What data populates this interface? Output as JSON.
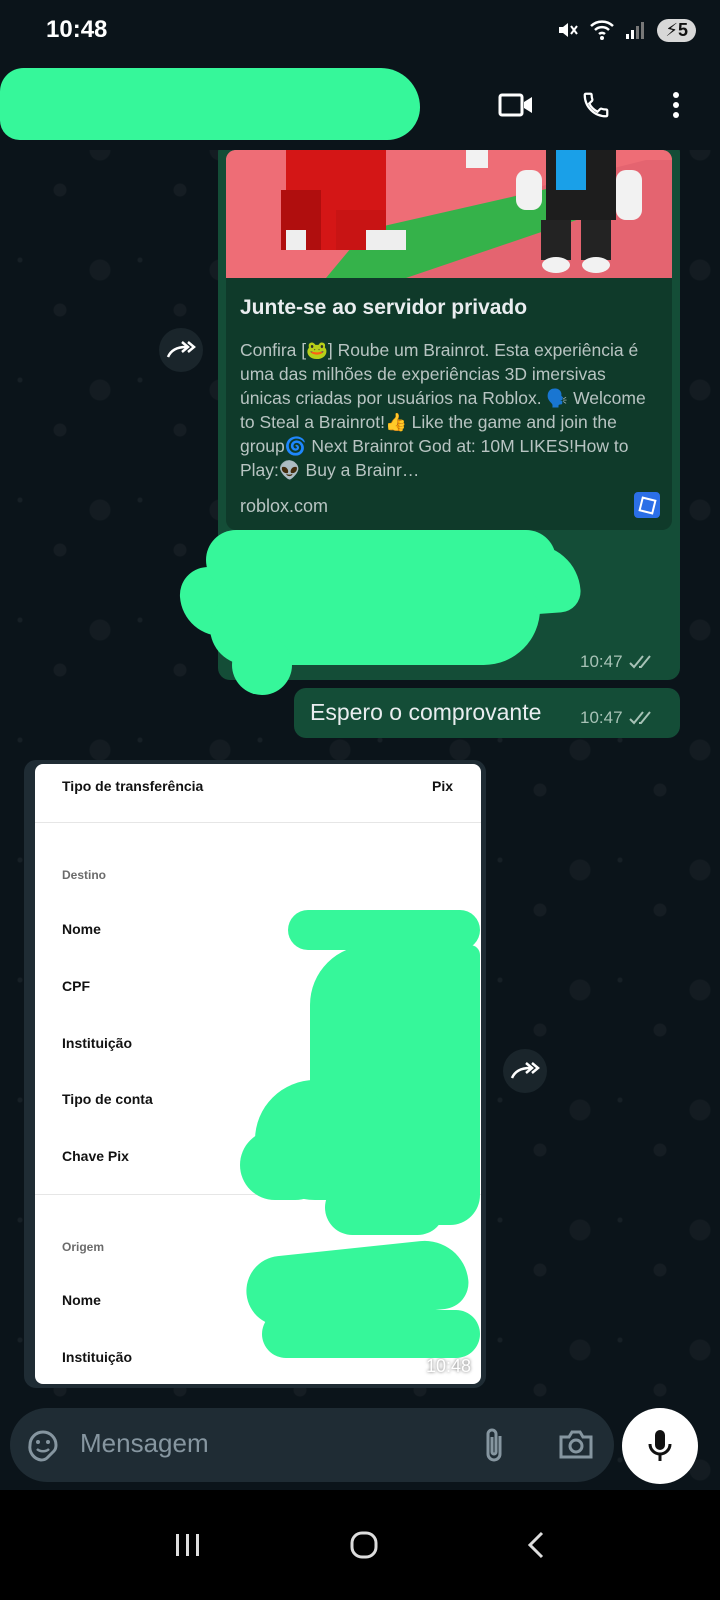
{
  "status_bar": {
    "time": "10:48",
    "battery": "5"
  },
  "header": {
    "icons": [
      "video-call-icon",
      "phone-icon",
      "more-vert-icon"
    ]
  },
  "link_preview": {
    "title": "Junte-se ao servidor privado",
    "description": "Confira [🐸] Roube um Brainrot. Esta experiência é uma das milhões de experiências 3D imersivas únicas criadas por usuários na Roblox. 🗣️ Welcome to Steal a Brainrot!👍 Like the game and join the group🌀 Next Brainrot God at: 10M LIKES!How to Play:👽 Buy a Brainr…",
    "domain": "roblox.com",
    "time": "10:47"
  },
  "message2": {
    "text": "Espero o comprovante",
    "time": "10:47"
  },
  "receipt": {
    "type_label": "Tipo de transferência",
    "type_value": "Pix",
    "dest_section": "Destino",
    "dest_fields": [
      "Nome",
      "CPF",
      "Instituição",
      "Tipo de conta",
      "Chave Pix"
    ],
    "origin_section": "Origem",
    "origin_fields": [
      "Nome",
      "Instituição"
    ],
    "time": "10:48"
  },
  "input": {
    "placeholder": "Mensagem"
  },
  "colors": {
    "background": "#0b141a",
    "outgoing_bubble": "#144d37",
    "redaction": "#36f79a",
    "input_bar": "#1f2c34"
  }
}
